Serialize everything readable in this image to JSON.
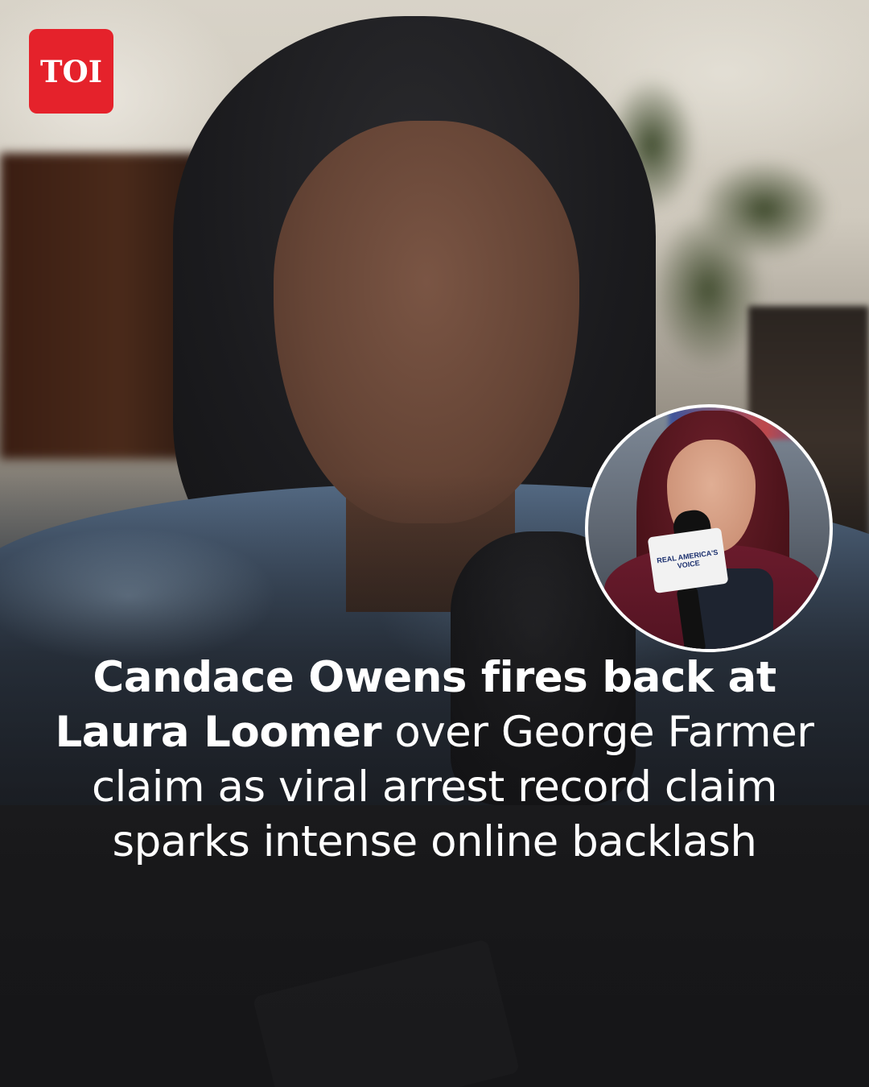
{
  "brand": {
    "logo_text": "TOI",
    "logo_color": "#e5222b"
  },
  "inset": {
    "mic_flag_text": "REAL AMERICA'S VOICE"
  },
  "headline": {
    "bold_part": "Candace Owens fires back at Laura Loomer",
    "regular_part": " over George Farmer claim as viral arrest record claim sparks intense online backlash"
  }
}
